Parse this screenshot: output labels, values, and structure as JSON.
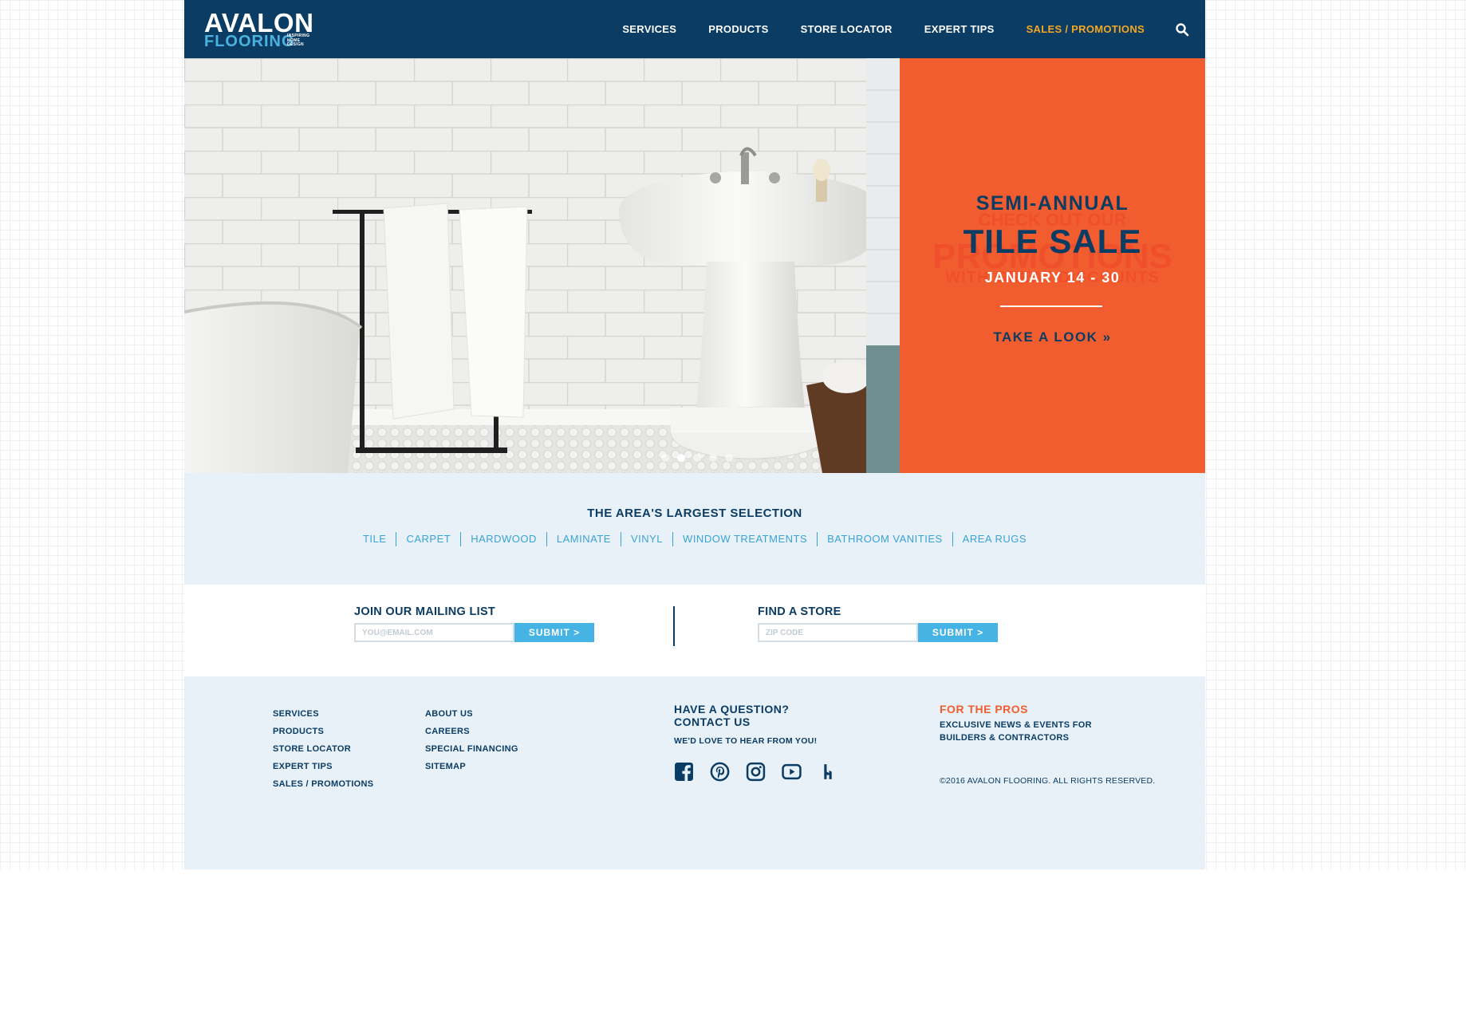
{
  "brand": {
    "name": "AVALON",
    "sub": "FLOORING",
    "tagline": [
      "INSPIRING",
      "HOME",
      "DESIGN"
    ]
  },
  "nav": {
    "items": [
      "SERVICES",
      "PRODUCTS",
      "STORE LOCATOR",
      "EXPERT TIPS",
      "SALES / PROMOTIONS"
    ],
    "active": "SALES / PROMOTIONS",
    "search_icon": "search-icon"
  },
  "hero": {
    "line1": "SEMI-ANNUAL",
    "line2": "TILE SALE",
    "line3": "JANUARY 14 - 30",
    "cta": "TAKE A LOOK »",
    "ghost_line1": "CHECK OUT OUR",
    "ghost_line2": "PROMOTIONS",
    "ghost_line3": "WITH GREAT DISCOUNTS",
    "slides": 5,
    "active_slide": 2,
    "promo_color": "#f25d2f"
  },
  "selection": {
    "title": "THE AREA'S LARGEST SELECTION",
    "links": [
      "TILE",
      "CARPET",
      "HARDWOOD",
      "LAMINATE",
      "VINYL",
      "WINDOW TREATMENTS",
      "BATHROOM VANITIES",
      "AREA RUGS"
    ]
  },
  "mailing": {
    "title": "JOIN OUR MAILING LIST",
    "placeholder": "YOU@EMAIL.COM",
    "button": "SUBMIT >"
  },
  "store": {
    "title": "FIND A STORE",
    "placeholder": "ZIP CODE",
    "button": "SUBMIT >"
  },
  "footer": {
    "col1": [
      "SERVICES",
      "PRODUCTS",
      "STORE LOCATOR",
      "EXPERT TIPS",
      "SALES / PROMOTIONS"
    ],
    "col2": [
      "ABOUT US",
      "CAREERS",
      "SPECIAL FINANCING",
      "SITEMAP"
    ],
    "contact_title_1": "HAVE A QUESTION?",
    "contact_title_2": "CONTACT US",
    "contact_sub": "WE'D LOVE TO HEAR FROM YOU!",
    "socials": [
      "facebook-icon",
      "pinterest-icon",
      "instagram-icon",
      "youtube-icon",
      "houzz-icon"
    ],
    "pros_title": "FOR THE PROS",
    "pros_text": "EXCLUSIVE NEWS & EVENTS FOR BUILDERS & CONTRACTORS",
    "copyright": "©2016 AVALON FLOORING. ALL RIGHTS RESERVED."
  },
  "colors": {
    "navy": "#0b3c63",
    "accent_orange": "#f25d2f",
    "nav_active": "#f5a623",
    "link_blue": "#3aa3d3",
    "button_blue": "#45b3e4",
    "light_bg": "#e8f1f8"
  }
}
